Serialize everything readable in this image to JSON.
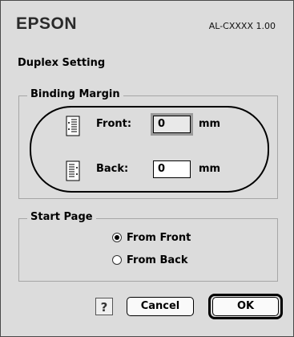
{
  "header": {
    "brand": "EPSON",
    "model": "AL-CXXXX 1.00"
  },
  "section_title": "Duplex Setting",
  "binding_margin": {
    "legend": "Binding Margin",
    "front": {
      "label": "Front:",
      "value": "0",
      "unit": "mm",
      "icon": "front-binding-page-icon"
    },
    "back": {
      "label": "Back:",
      "value": "0",
      "unit": "mm",
      "icon": "back-binding-page-icon"
    }
  },
  "start_page": {
    "legend": "Start Page",
    "options": [
      {
        "label": "From Front",
        "selected": true
      },
      {
        "label": "From Back",
        "selected": false
      }
    ]
  },
  "buttons": {
    "help": "?",
    "cancel": "Cancel",
    "ok": "OK"
  }
}
